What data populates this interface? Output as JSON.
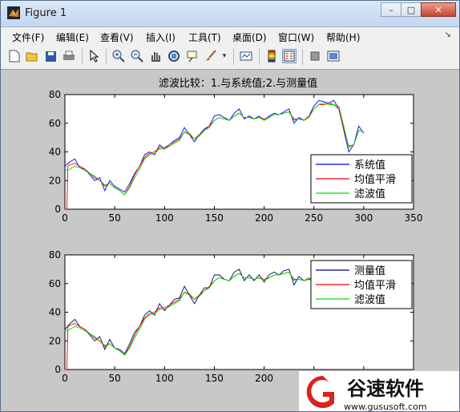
{
  "window": {
    "title": "Figure 1"
  },
  "window_buttons": {
    "minimize": "–",
    "maximize": "□",
    "close": "✕"
  },
  "menu": [
    {
      "label": "文件(F)"
    },
    {
      "label": "编辑(E)"
    },
    {
      "label": "查看(V)"
    },
    {
      "label": "插入(I)"
    },
    {
      "label": "工具(T)"
    },
    {
      "label": "桌面(D)"
    },
    {
      "label": "窗口(W)"
    },
    {
      "label": "帮助(H)"
    }
  ],
  "toolbar_icons": [
    "new-file-icon",
    "open-folder-icon",
    "save-icon",
    "print-icon",
    "pointer-icon",
    "zoom-in-icon",
    "zoom-out-icon",
    "pan-icon",
    "rotate-3d-icon",
    "data-cursor-icon",
    "brush-icon",
    "link-plot-icon",
    "colorbar-icon",
    "legend-icon",
    "hide-plot-tools-icon",
    "show-plot-tools-icon"
  ],
  "watermark": {
    "brand": "谷速软件",
    "url": "www.gususoft.com"
  },
  "chart_data": [
    {
      "type": "line",
      "title": "滤波比较：1.与系统值;2.与测量值",
      "xlim": [
        0,
        350
      ],
      "ylim": [
        0,
        80
      ],
      "xticks": [
        0,
        50,
        100,
        150,
        200,
        250,
        300,
        350
      ],
      "yticks": [
        0,
        20,
        40,
        60,
        80
      ],
      "legend_position": "lower-right",
      "series": [
        {
          "name": "系统值",
          "color": "#0000ff",
          "x": [
            0,
            5,
            10,
            15,
            20,
            25,
            30,
            35,
            40,
            45,
            50,
            55,
            60,
            65,
            70,
            75,
            80,
            85,
            90,
            95,
            100,
            105,
            110,
            115,
            120,
            125,
            130,
            135,
            140,
            145,
            150,
            155,
            160,
            165,
            170,
            175,
            180,
            185,
            190,
            195,
            200,
            205,
            210,
            215,
            220,
            225,
            230,
            235,
            240,
            245,
            250,
            255,
            260,
            265,
            270,
            275,
            280,
            285,
            290,
            295,
            300
          ],
          "y": [
            30,
            33,
            35,
            29,
            28,
            24,
            20,
            22,
            13,
            20,
            16,
            14,
            12,
            18,
            25,
            30,
            38,
            40,
            38,
            45,
            42,
            45,
            48,
            50,
            57,
            52,
            47,
            52,
            56,
            58,
            65,
            66,
            64,
            62,
            67,
            70,
            63,
            65,
            63,
            65,
            62,
            65,
            67,
            66,
            68,
            70,
            60,
            64,
            62,
            65,
            72,
            76,
            75,
            74,
            76,
            70,
            55,
            40,
            45,
            58,
            53
          ]
        },
        {
          "name": "均值平滑",
          "color": "#ff0000",
          "x": [
            0,
            2,
            3,
            5,
            10,
            15,
            20,
            25,
            30,
            35,
            40,
            45,
            50,
            55,
            60,
            65,
            70,
            75,
            80,
            85,
            90,
            95,
            100,
            105,
            110,
            115,
            120,
            125,
            130,
            135,
            140,
            145,
            150,
            155,
            160,
            165,
            170,
            175,
            180,
            185,
            190,
            195,
            200,
            205,
            210,
            215,
            220,
            225,
            230,
            235,
            240,
            245,
            250,
            255,
            260,
            265,
            270,
            275,
            280,
            285,
            290,
            295,
            300
          ],
          "y": [
            0,
            0,
            30,
            31,
            32,
            30,
            28,
            25,
            22,
            20,
            16,
            18,
            15,
            13,
            10,
            16,
            24,
            30,
            36,
            39,
            40,
            43,
            43,
            45,
            47,
            49,
            54,
            52,
            49,
            52,
            55,
            58,
            62,
            64,
            63,
            62,
            65,
            67,
            64,
            64,
            63,
            64,
            63,
            64,
            66,
            66,
            67,
            68,
            63,
            63,
            62,
            65,
            70,
            73,
            73,
            74,
            73,
            70,
            56,
            44,
            45,
            55,
            54
          ]
        },
        {
          "name": "滤波值",
          "color": "#00dd00",
          "x": [
            0,
            5,
            10,
            15,
            20,
            25,
            30,
            35,
            40,
            45,
            50,
            55,
            60,
            65,
            70,
            75,
            80,
            85,
            90,
            95,
            100,
            105,
            110,
            115,
            120,
            125,
            130,
            135,
            140,
            145,
            150,
            155,
            160,
            165,
            170,
            175,
            180,
            185,
            190,
            195,
            200,
            205,
            210,
            215,
            220,
            225,
            230,
            235,
            240,
            245,
            250,
            255,
            260,
            265,
            270,
            275,
            280,
            285,
            290,
            295,
            300
          ],
          "y": [
            27,
            28,
            30,
            29,
            27,
            25,
            23,
            20,
            17,
            18,
            15,
            13,
            10,
            15,
            22,
            28,
            35,
            38,
            39,
            42,
            42,
            44,
            46,
            48,
            54,
            53,
            49,
            51,
            55,
            57,
            62,
            64,
            63,
            62,
            65,
            67,
            64,
            64,
            63,
            64,
            62,
            64,
            66,
            66,
            67,
            68,
            62,
            63,
            62,
            64,
            70,
            73,
            74,
            73,
            73,
            72,
            58,
            43,
            45,
            55,
            54
          ]
        }
      ]
    },
    {
      "type": "line",
      "xlim": [
        0,
        350
      ],
      "ylim": [
        0,
        80
      ],
      "xticks": [
        0,
        50,
        100,
        150,
        200,
        250,
        300,
        350
      ],
      "yticks": [
        0,
        20,
        40,
        60,
        80
      ],
      "legend_position": "top-right",
      "series": [
        {
          "name": "测量值",
          "color": "#000080",
          "x": [
            0,
            5,
            10,
            15,
            20,
            25,
            30,
            35,
            40,
            45,
            50,
            55,
            60,
            65,
            70,
            75,
            80,
            85,
            90,
            95,
            100,
            105,
            110,
            115,
            120,
            125,
            130,
            135,
            140,
            145,
            150,
            155,
            160,
            165,
            170,
            175,
            180,
            185,
            190,
            195,
            200,
            205,
            210,
            215,
            220,
            225,
            230,
            235,
            240,
            245,
            250
          ],
          "y": [
            28,
            32,
            35,
            30,
            28,
            24,
            20,
            23,
            14,
            21,
            15,
            14,
            11,
            18,
            26,
            30,
            38,
            41,
            38,
            46,
            41,
            45,
            49,
            50,
            58,
            52,
            46,
            52,
            57,
            57,
            66,
            66,
            63,
            62,
            68,
            70,
            62,
            66,
            62,
            66,
            61,
            66,
            68,
            66,
            69,
            70,
            59,
            65,
            62,
            64,
            60
          ]
        },
        {
          "name": "均值平滑",
          "color": "#ff0000",
          "x": [
            0,
            2,
            3,
            5,
            10,
            15,
            20,
            25,
            30,
            35,
            40,
            45,
            50,
            55,
            60,
            65,
            70,
            75,
            80,
            85,
            90,
            95,
            100,
            105,
            110,
            115,
            120,
            125,
            130,
            135,
            140,
            145,
            150,
            155,
            160,
            165,
            170,
            175,
            180,
            185,
            190,
            195,
            200,
            205,
            210,
            215,
            220,
            225,
            230,
            235,
            240,
            245,
            250
          ],
          "y": [
            0,
            0,
            30,
            31,
            32,
            30,
            28,
            25,
            22,
            20,
            16,
            18,
            15,
            13,
            10,
            16,
            24,
            30,
            36,
            39,
            40,
            43,
            43,
            45,
            47,
            49,
            54,
            52,
            49,
            52,
            55,
            58,
            62,
            64,
            63,
            62,
            65,
            67,
            64,
            64,
            63,
            64,
            63,
            64,
            66,
            66,
            67,
            68,
            63,
            63,
            62,
            63,
            61
          ]
        },
        {
          "name": "滤波值",
          "color": "#00dd00",
          "x": [
            0,
            5,
            10,
            15,
            20,
            25,
            30,
            35,
            40,
            45,
            50,
            55,
            60,
            65,
            70,
            75,
            80,
            85,
            90,
            95,
            100,
            105,
            110,
            115,
            120,
            125,
            130,
            135,
            140,
            145,
            150,
            155,
            160,
            165,
            170,
            175,
            180,
            185,
            190,
            195,
            200,
            205,
            210,
            215,
            220,
            225,
            230,
            235,
            240,
            245,
            250
          ],
          "y": [
            27,
            28,
            30,
            29,
            27,
            25,
            23,
            20,
            17,
            18,
            15,
            13,
            10,
            15,
            22,
            28,
            35,
            38,
            39,
            42,
            42,
            44,
            46,
            48,
            54,
            53,
            49,
            51,
            55,
            57,
            62,
            64,
            63,
            62,
            65,
            67,
            64,
            64,
            63,
            64,
            62,
            64,
            66,
            66,
            67,
            68,
            62,
            63,
            62,
            64,
            61
          ]
        }
      ]
    }
  ]
}
